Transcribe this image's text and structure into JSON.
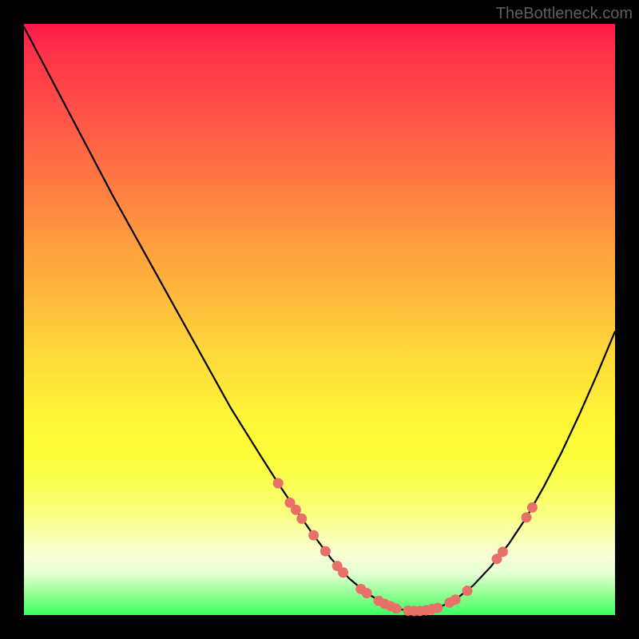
{
  "watermark": "TheBottleneck.com",
  "colors": {
    "background": "#000000",
    "gradient_top": "#ff1a4a",
    "gradient_bottom": "#3cff62",
    "line": "#000000",
    "dot": "#e77068"
  },
  "chart_data": {
    "type": "line",
    "title": "",
    "xlabel": "",
    "ylabel": "",
    "note": "Bottleneck-style valley curve. y maps 0→bottom (green, no bottleneck) to 100→top (red, high bottleneck). Curve reaches minimum near x≈65.",
    "x": [
      0,
      5,
      10,
      15,
      20,
      25,
      30,
      35,
      40,
      43,
      46,
      49,
      52,
      55,
      58,
      61,
      64,
      67,
      70,
      73,
      76,
      79,
      82,
      85,
      88,
      91,
      94,
      97,
      100
    ],
    "y": [
      99.5,
      90,
      80.5,
      71,
      62,
      53,
      44,
      35,
      27,
      22.3,
      17.8,
      13.5,
      9.5,
      6.2,
      3.7,
      1.9,
      0.9,
      0.7,
      1.2,
      2.6,
      5.0,
      8.2,
      12.0,
      16.5,
      21.8,
      27.6,
      34.0,
      40.8,
      48.0
    ],
    "xlim": [
      0,
      100
    ],
    "ylim": [
      0,
      100
    ],
    "dots": {
      "note": "Highlighted sample points on the curve in the lower region",
      "points": [
        {
          "x": 43,
          "y": 22.3
        },
        {
          "x": 45,
          "y": 19.0
        },
        {
          "x": 46,
          "y": 17.8
        },
        {
          "x": 47,
          "y": 16.3
        },
        {
          "x": 49,
          "y": 13.5
        },
        {
          "x": 51,
          "y": 10.8
        },
        {
          "x": 53,
          "y": 8.3
        },
        {
          "x": 54,
          "y": 7.2
        },
        {
          "x": 57,
          "y": 4.4
        },
        {
          "x": 58,
          "y": 3.7
        },
        {
          "x": 60,
          "y": 2.4
        },
        {
          "x": 61,
          "y": 1.9
        },
        {
          "x": 62,
          "y": 1.5
        },
        {
          "x": 63,
          "y": 1.1
        },
        {
          "x": 65,
          "y": 0.75
        },
        {
          "x": 66,
          "y": 0.7
        },
        {
          "x": 67,
          "y": 0.7
        },
        {
          "x": 68,
          "y": 0.8
        },
        {
          "x": 69,
          "y": 1.0
        },
        {
          "x": 70,
          "y": 1.2
        },
        {
          "x": 72,
          "y": 2.1
        },
        {
          "x": 73,
          "y": 2.6
        },
        {
          "x": 75,
          "y": 4.1
        },
        {
          "x": 80,
          "y": 9.5
        },
        {
          "x": 81,
          "y": 10.7
        },
        {
          "x": 85,
          "y": 16.5
        },
        {
          "x": 86,
          "y": 18.2
        }
      ]
    }
  }
}
